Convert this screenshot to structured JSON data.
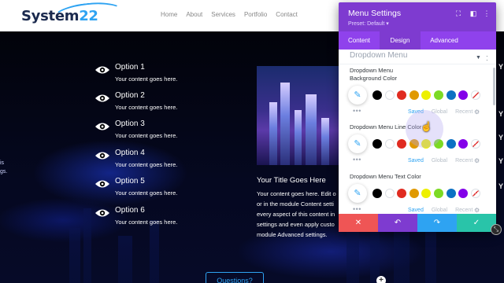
{
  "site": {
    "logo_text": "System",
    "logo_num": "22",
    "nav": [
      "Home",
      "About",
      "Services",
      "Portfolio",
      "Contact"
    ],
    "left_partial_lines": [
      "is",
      "gs."
    ],
    "options": [
      {
        "title": "Option 1",
        "desc": "Your content goes here."
      },
      {
        "title": "Option 2",
        "desc": "Your content goes here."
      },
      {
        "title": "Option 3",
        "desc": "Your content goes here."
      },
      {
        "title": "Option 4",
        "desc": "Your content goes here."
      },
      {
        "title": "Option 5",
        "desc": "Your content goes here."
      },
      {
        "title": "Option 6",
        "desc": "Your content goes here."
      }
    ],
    "card": {
      "title": "Your Title Goes Here",
      "lines": [
        "Your content goes here. Edit o",
        "or in the module Content setti",
        "every aspect of this content in",
        "settings and even apply custo",
        "module Advanced settings."
      ]
    },
    "questions_button": "Questions?",
    "right_peek": [
      "Y",
      "Y",
      "Y",
      "Y",
      "Y"
    ]
  },
  "panel": {
    "title": "Menu Settings",
    "preset": "Preset: Default ▾",
    "tabs": [
      {
        "label": "Content",
        "active": false
      },
      {
        "label": "Design",
        "active": true
      },
      {
        "label": "Advanced",
        "active": false
      }
    ],
    "section_title": "Dropdown Menu",
    "fields": [
      {
        "label_line1": "Dropdown Menu",
        "label_line2": "Background Color"
      },
      {
        "label_line1": "Dropdown Menu Line Color",
        "label_line2": ""
      },
      {
        "label_line1": "Dropdown Menu Text Color",
        "label_line2": ""
      }
    ],
    "swatch_colors": [
      "#000000",
      "#ffffff",
      "#e02b20",
      "#e09900",
      "#edf000",
      "#7cda24",
      "#0c71c3",
      "#8300e9"
    ],
    "color_tabs": [
      "Saved",
      "Global",
      "Recent"
    ],
    "actions": [
      {
        "icon": "✕",
        "color": "#ef5555"
      },
      {
        "icon": "↶",
        "color": "#7e3bd0"
      },
      {
        "icon": "↷",
        "color": "#2ea3f2"
      },
      {
        "icon": "✓",
        "color": "#29c4a9"
      }
    ]
  },
  "colors": {
    "panel_header": "#7e3bd0",
    "panel_tabs": "#8f42ec",
    "accent_blue": "#2ea3f2"
  }
}
